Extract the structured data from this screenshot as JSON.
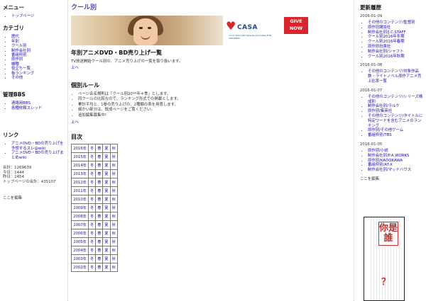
{
  "left": {
    "menu_title": "メニュー",
    "menu_items": [
      "トップページ"
    ],
    "category_title": "カテゴリ",
    "category_items": [
      "歴代",
      "年別",
      "クール別",
      "制作会社別",
      "番組枠別",
      "原作別",
      "機種",
      "役立ち一覧",
      "板ランキング",
      "その他"
    ],
    "bbs_title": "管理BBS",
    "bbs_items": [
      "連絡用BBS",
      "各種依頼スレッド"
    ],
    "link_title": "リンク",
    "link_items": [
      "アニメDVD・BDの売り上げを予想するスレ@wiki",
      "アニメDVD・BDの売り上げまとめwiki"
    ],
    "stats": [
      "合計：1269639",
      "今日：1444",
      "昨日：2454",
      "トップページの合計：435107"
    ],
    "edit": "ここを編集"
  },
  "main": {
    "title": "クール別",
    "banner": {
      "logo": "CASA",
      "logo_sub": "Court Appointed Special Advocates FOR CHILDREN",
      "give_line1": "GIVE",
      "give_line2": "NOW"
    },
    "section1_title": "年別アニメDVD・BD売り上げ一覧",
    "section1_desc": "TV放送開始クール別の、アニメ売り上げの一覧を取り扱います。",
    "up": "上へ",
    "section2_title": "個別ルール",
    "rules": [
      "ページ名名規則は「クール別20**年＊季」とします。",
      "同クールの比較なので、ランキング形式での掲載とします。",
      "累計平均と、1巻の売り上げの、2種類の表を用意します。",
      "細かい部分は、既成ページをご覧ください。",
      "追加編集募集中!"
    ],
    "up2": "上へ",
    "toc_title": "目次",
    "seasons": [
      "冬",
      "春",
      "夏",
      "秋"
    ],
    "years": [
      "2016年",
      "2015年",
      "2014年",
      "2013年",
      "2012年",
      "2011年",
      "2010年",
      "2009年",
      "2008年",
      "2007年",
      "2006年",
      "2005年",
      "2004年",
      "2003年",
      "2002年"
    ]
  },
  "right": {
    "title": "更新履歴",
    "groups": [
      {
        "date": "2016-01-09",
        "items": [
          "その他のコンテンツ/監督別",
          "原作別講談社",
          "制作会社別/J.C.STAFF",
          "クール別2016年冬期",
          "クール別2016年春期",
          "原作別白泉社",
          "制作会社別/シャフト",
          "クール別2016年秋期"
        ]
      },
      {
        "date": "2016-01-08",
        "items": [
          "その他のコンテンツ/対象作品数・ライトノベル原作アニメ売上比率一覧"
        ]
      },
      {
        "date": "2016-01-07",
        "items": [
          "その他のコンテンツ/シリーズ構成別",
          "制作会社別/ラルケ",
          "原作別/集英社",
          "その他のコンテンツ/タイトルに特定ワードを含むアニメのランキング",
          "原作別/その他ゲーム",
          "番組枠別/TBS"
        ]
      },
      {
        "date": "2016-01-05",
        "items": [
          "原作別/小説",
          "制作会社別/P.A.WORKS",
          "原作別/KADOKAWA",
          "番組枠別/AT-X",
          "制作会社別/マッドハウス"
        ]
      }
    ],
    "edit": "ここを編集",
    "manga_text": "你是誰",
    "manga_q": "？"
  }
}
